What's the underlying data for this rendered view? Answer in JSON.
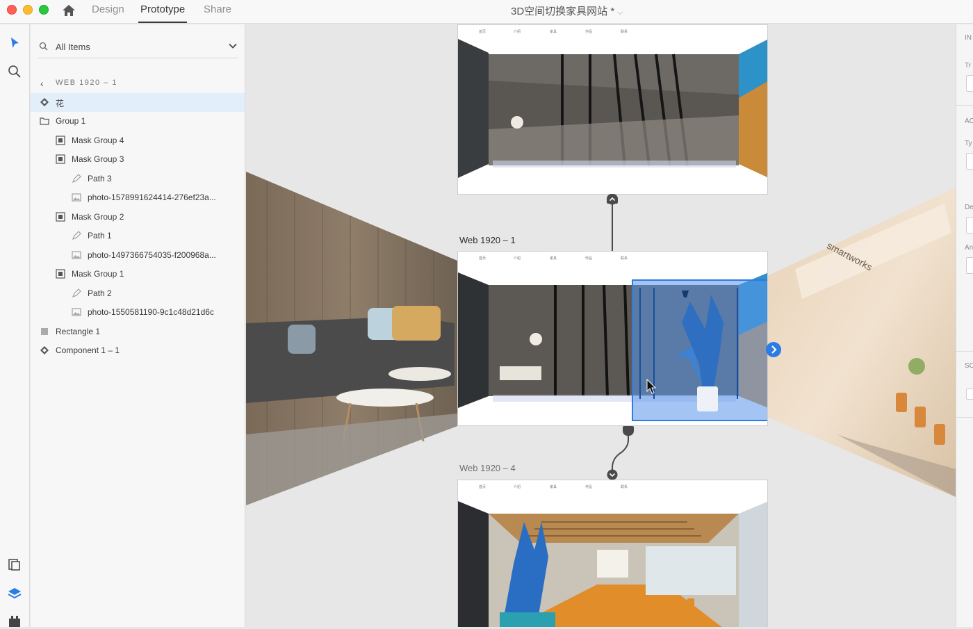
{
  "titlebar": {
    "tabs": [
      "Design",
      "Prototype",
      "Share"
    ],
    "active_tab": "Prototype",
    "document_title": "3D空间切换家具网站 *"
  },
  "layers": {
    "filter_label": "All Items",
    "breadcrumb": "WEB 1920 – 1",
    "items": [
      {
        "label": "花",
        "icon": "component-icon",
        "selected": true
      },
      {
        "label": "Group 1",
        "icon": "folder-icon"
      },
      {
        "label": "Mask Group 4",
        "icon": "mask-group-icon"
      },
      {
        "label": "Mask Group 3",
        "icon": "mask-group-icon"
      },
      {
        "label": "Path 3",
        "icon": "path-icon"
      },
      {
        "label": "photo-1578991624414-276ef23a...",
        "icon": "image-icon"
      },
      {
        "label": "Mask Group 2",
        "icon": "mask-group-icon"
      },
      {
        "label": "Path 1",
        "icon": "path-icon"
      },
      {
        "label": "photo-1497366754035-f200968a...",
        "icon": "image-icon"
      },
      {
        "label": "Mask Group 1",
        "icon": "mask-group-icon"
      },
      {
        "label": "Path 2",
        "icon": "path-icon"
      },
      {
        "label": "photo-1550581190-9c1c48d21d6c",
        "icon": "image-icon"
      },
      {
        "label": "Rectangle 1",
        "icon": "rectangle-icon"
      },
      {
        "label": "Component 1 – 1",
        "icon": "component-icon"
      }
    ]
  },
  "canvas": {
    "artboards": [
      {
        "label": "",
        "nav_links": [
          "首页",
          "介绍",
          "家具",
          "作品",
          "联系"
        ]
      },
      {
        "label": "Web 1920 – 1",
        "nav_links": [
          "首页",
          "介绍",
          "家具",
          "作品",
          "联系"
        ]
      },
      {
        "label": "Web 1920 – 4",
        "nav_links": [
          "首页",
          "介绍",
          "家具",
          "作品",
          "联系"
        ]
      }
    ],
    "signage_text": "smartworks",
    "selection_color": "#2d7be5"
  },
  "properties": {
    "labels": [
      "IN",
      "Tr",
      "AC",
      "Ty",
      "De",
      "An",
      "SC"
    ]
  },
  "colors": {
    "accent": "#2d7be5",
    "selection_fill": "#8fb8f0",
    "wire": "#4a4a4a"
  }
}
